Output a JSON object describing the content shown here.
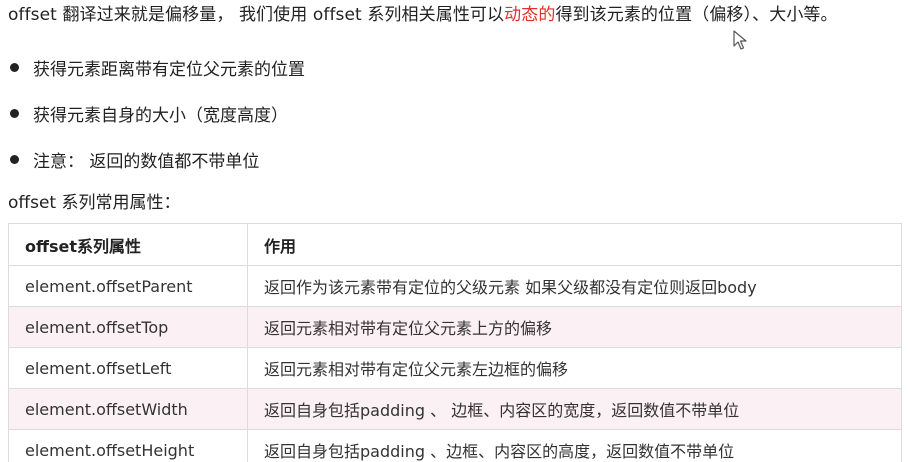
{
  "intro": {
    "before": "offset 翻译过来就是偏移量， 我们使用 offset 系列相关属性可以",
    "highlight": "动态的",
    "after": "得到该元素的位置（偏移）、大小等。"
  },
  "bullets": [
    "获得元素距离带有定位父元素的位置",
    "获得元素自身的大小（宽度高度）",
    "注意： 返回的数值都不带单位"
  ],
  "section_title": "offset 系列常用属性：",
  "table": {
    "headers": [
      "offset系列属性",
      "作用"
    ],
    "rows": [
      [
        "element.offsetParent",
        "返回作为该元素带有定位的父级元素 如果父级都没有定位则返回body"
      ],
      [
        "element.offsetTop",
        "返回元素相对带有定位父元素上方的偏移"
      ],
      [
        "element.offsetLeft",
        "返回元素相对带有定位父元素左边框的偏移"
      ],
      [
        "element.offsetWidth",
        "返回自身包括padding 、 边框、内容区的宽度，返回数值不带单位"
      ],
      [
        "element.offsetHeight",
        "返回自身包括padding 、边框、内容区的高度，返回数值不带单位"
      ]
    ]
  },
  "colors": {
    "highlight": "#e0312b",
    "row_alt": "#fbf0f3",
    "border": "#dcdcdc"
  },
  "icons": {
    "cursor": "mouse-pointer-icon"
  }
}
